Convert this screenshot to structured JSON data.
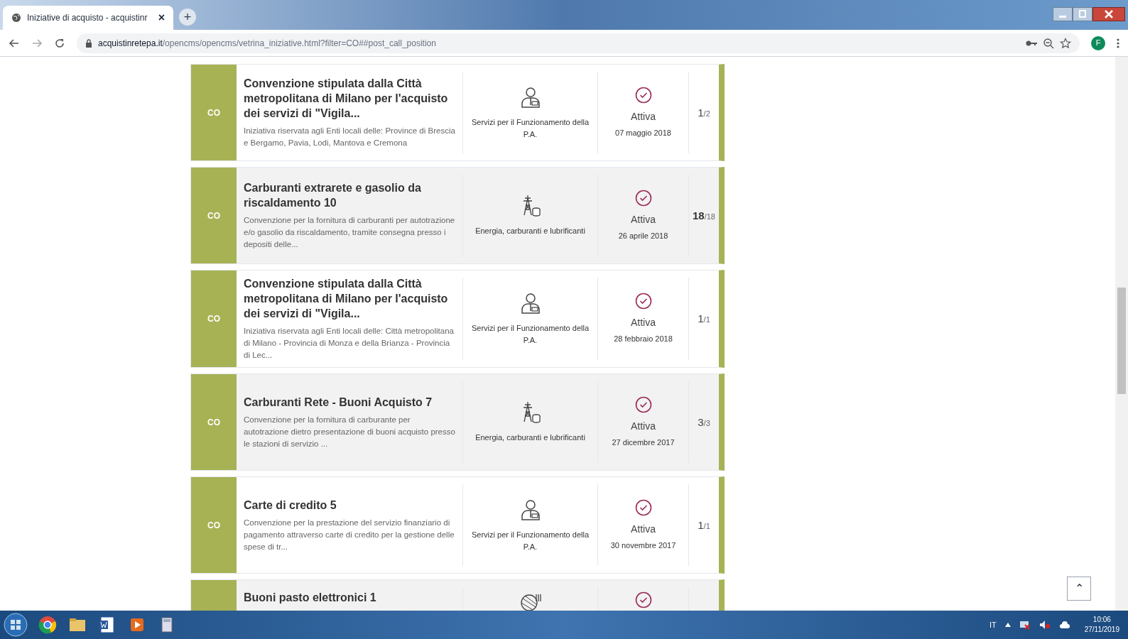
{
  "browser": {
    "tab": {
      "title": "Iniziative di acquisto - acquistinr",
      "close": "×"
    },
    "new_tab": "+",
    "url": {
      "host": "acquistinretepa.it",
      "path": "/opencms/opencms/vetrina_iniziative.html?filter=CO##post_call_position"
    },
    "profile": "F"
  },
  "initiatives": [
    {
      "badge": "CO",
      "title": "Convenzione stipulata dalla Città metropolitana di Milano per l'acquisto dei servizi di \"Vigila...",
      "description": "Iniziativa riservata agli Enti locali delle: Province di Brescia e Bergamo, Pavia, Lodi, Mantova e Cremona",
      "category": {
        "kind": "services",
        "label": "Servizi per il Funzionamento della P.A."
      },
      "status": "Attiva",
      "date": "07 maggio 2018",
      "count": "1",
      "total": "/2"
    },
    {
      "badge": "CO",
      "title": "Carburanti extrarete e gasolio da riscaldamento 10",
      "description": "Convenzione per la fornitura di carburanti per autotrazione e/o gasolio da riscaldamento, tramite consegna presso i depositi delle...",
      "category": {
        "kind": "energy",
        "label": "Energia, carburanti e lubrificanti"
      },
      "status": "Attiva",
      "date": "26 aprile 2018",
      "count": "18",
      "total": "/18"
    },
    {
      "badge": "CO",
      "title": "Convenzione stipulata dalla Città metropolitana di Milano per l'acquisto dei servizi di \"Vigila...",
      "description": "Iniziativa riservata agli Enti locali delle: Città metropolitana di Milano - Provincia di Monza e della Brianza - Provincia di Lec...",
      "category": {
        "kind": "services",
        "label": "Servizi per il Funzionamento della P.A."
      },
      "status": "Attiva",
      "date": "28 febbraio 2018",
      "count": "1",
      "total": "/1"
    },
    {
      "badge": "CO",
      "title": "Carburanti Rete - Buoni Acquisto 7",
      "description": "Convenzione per la fornitura di carburante per autotrazione dietro presentazione di buoni acquisto presso le stazioni di servizio ...",
      "category": {
        "kind": "energy",
        "label": "Energia, carburanti e lubrificanti"
      },
      "status": "Attiva",
      "date": "27 dicembre 2017",
      "count": "3",
      "total": "/3"
    },
    {
      "badge": "CO",
      "title": "Carte di credito 5",
      "description": "Convenzione per la prestazione del servizio finanziario di pagamento attraverso carte di credito per la gestione delle spese di tr...",
      "category": {
        "kind": "services",
        "label": "Servizi per il Funzionamento della P.A."
      },
      "status": "Attiva",
      "date": "30 novembre 2017",
      "count": "1",
      "total": "/1"
    },
    {
      "title": "Buoni pasto elettronici 1",
      "category": {
        "kind": "food"
      }
    }
  ],
  "scroll_top": "⌃",
  "taskbar": {
    "language": "IT",
    "time": "10:06",
    "date": "27/11/2019"
  }
}
